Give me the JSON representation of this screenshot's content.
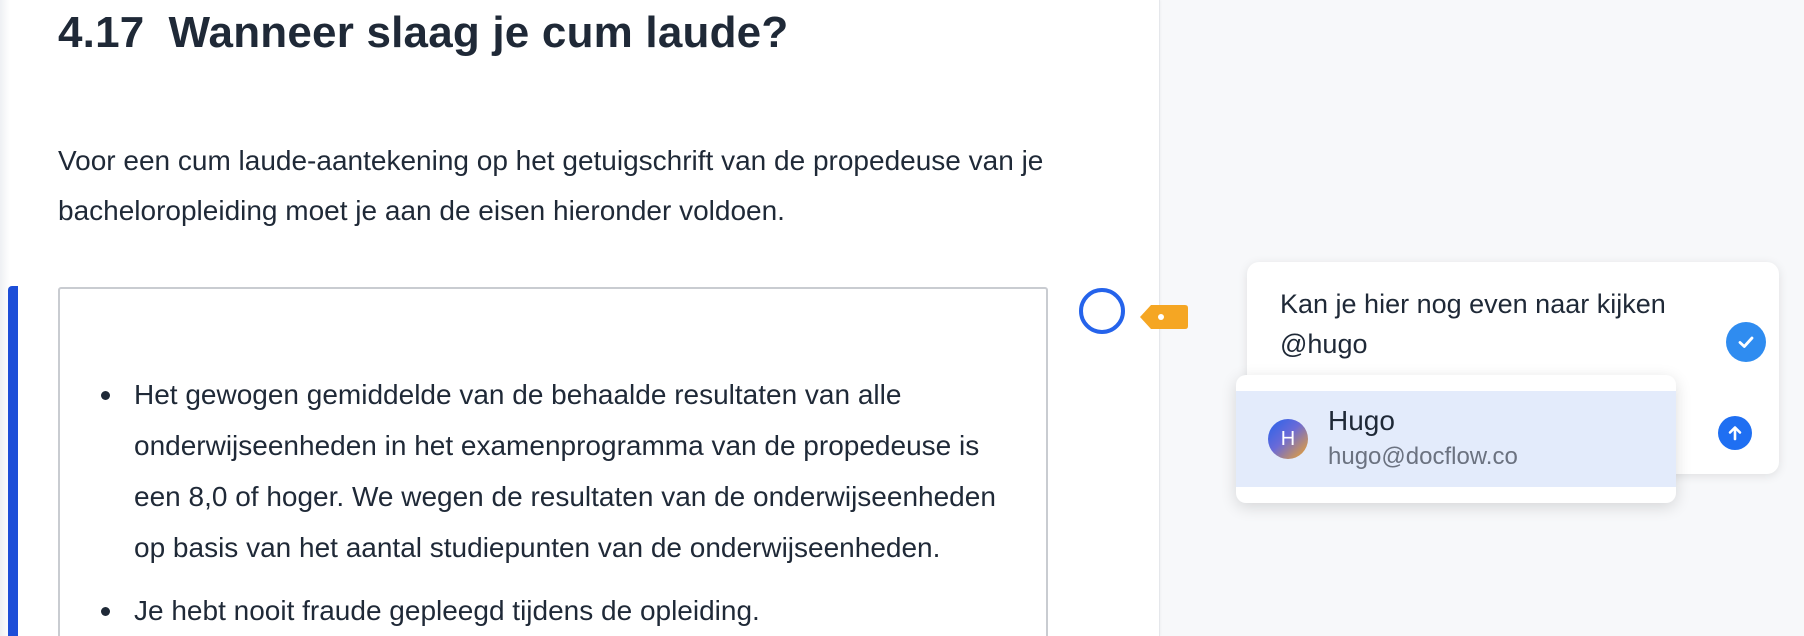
{
  "document": {
    "section_number": "4.17",
    "section_title": "Wanneer slaag je cum laude?",
    "intro": "Voor een cum laude-aantekening op het getuigschrift van de propedeuse van je bacheloropleiding moet je aan de eisen hieronder voldoen.",
    "bullets": [
      {
        "text": "Het gewogen gemiddelde van de behaalde resultaten van alle onderwijseenheden in het examenprogramma van de propedeuse is een 8,0 of hoger. We wegen de resultaten van de onderwijseenheden op basis van het aantal studiepunten van de onderwijseenheden."
      },
      {
        "text": "Je hebt nooit fraude gepleegd tijdens de opleiding."
      }
    ]
  },
  "comment": {
    "text": "Kan je hier nog even naar kijken",
    "mention": "@hugo",
    "resolve_icon": "check-icon",
    "send_icon": "arrow-up-icon"
  },
  "mention_dropdown": {
    "options": [
      {
        "initial": "H",
        "name": "Hugo",
        "email": "hugo@docflow.co"
      }
    ]
  },
  "colors": {
    "accent": "#1d4ed8",
    "anchor": "#2563eb",
    "tag": "#f5a623",
    "button": "#2f8cf0",
    "highlight": "#e3ebfb"
  }
}
